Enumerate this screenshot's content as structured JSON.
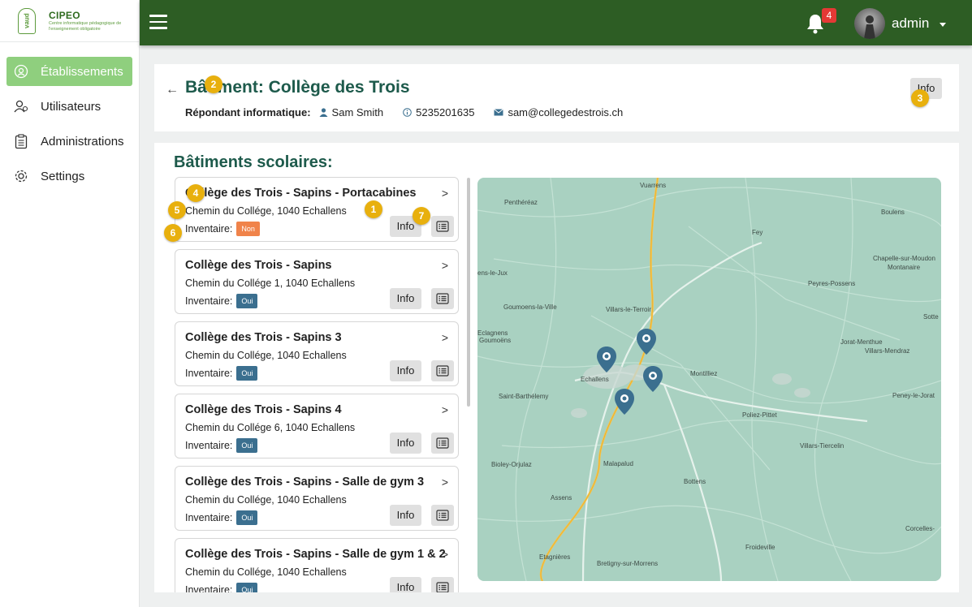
{
  "brand": {
    "title": "CIPEO",
    "subtitle": "Centre informatique pédagogique de l'enseignement obligatoire",
    "logo_text": "vaud"
  },
  "sidebar": {
    "items": [
      {
        "label": "Établissements",
        "icon": "school-icon",
        "active": true
      },
      {
        "label": "Utilisateurs",
        "icon": "users-icon",
        "active": false
      },
      {
        "label": "Administrations",
        "icon": "clipboard-icon",
        "active": false
      },
      {
        "label": "Settings",
        "icon": "gear-icon",
        "active": false
      }
    ]
  },
  "topbar": {
    "notification_count": "4",
    "username": "admin"
  },
  "header": {
    "title": "Bâtiment: Collège des Trois",
    "respondent_label": "Répondant informatique:",
    "respondent_name": "Sam Smith",
    "respondent_phone": "5235201635",
    "respondent_email": "sam@collegedestrois.ch",
    "info_label": "Info"
  },
  "buildings": {
    "title": "Bâtiments scolaires:",
    "inventory_label": "Inventaire:",
    "info_label": "Info",
    "items": [
      {
        "name": "Collège des Trois - Sapins - Portacabines",
        "address": "Chemin du Collége, 1040 Echallens",
        "inventory": "Non"
      },
      {
        "name": "Collège des Trois - Sapins",
        "address": "Chemin du Collége 1, 1040 Echallens",
        "inventory": "Oui"
      },
      {
        "name": "Collège des Trois - Sapins 3",
        "address": "Chemin du Collége, 1040 Echallens",
        "inventory": "Oui"
      },
      {
        "name": "Collège des Trois - Sapins 4",
        "address": "Chemin du Collége 6, 1040 Echallens",
        "inventory": "Oui"
      },
      {
        "name": "Collège des Trois - Sapins - Salle de gym 3",
        "address": "Chemin du Collége, 1040 Echallens",
        "inventory": "Oui"
      },
      {
        "name": "Collège des Trois - Sapins - Salle de gym 1 & 2",
        "address": "Chemin du Collége, 1040 Echallens",
        "inventory": "Oui"
      }
    ]
  },
  "map": {
    "labels": [
      "Vuarrens",
      "Penthéréaz",
      "Fey",
      "Boulens",
      "Chapelle-sur-Moudon",
      "Montanaire",
      "Peyres-Possens",
      "Villars-le-Terroir",
      "Goumoens-la-Ville",
      "Eclagnens",
      "Goumoëns",
      "Echallens",
      "Jorat-Menthue",
      "Villars-Mendraz",
      "Saint-Barthélemy",
      "Montilliez",
      "Peney-le-Jorat",
      "Poliez-Pittet",
      "Villars-Tiercelin",
      "Bioley-Orjulaz",
      "Malapalud",
      "Bottens",
      "Assens",
      "Corcelles-",
      "Froideville",
      "Etagnières",
      "Bretigny-sur-Morrens",
      "Sotte",
      "ens-le-Jux"
    ]
  },
  "tour_steps": [
    "1",
    "2",
    "3",
    "4",
    "5",
    "6",
    "7"
  ],
  "colors": {
    "topbar": "#2d5d24",
    "active_nav": "#8fcf7e",
    "title": "#1d5a4b",
    "badge_oui": "#3b6f8f",
    "badge_non": "#f0834a",
    "tour": "#e8b00e"
  }
}
